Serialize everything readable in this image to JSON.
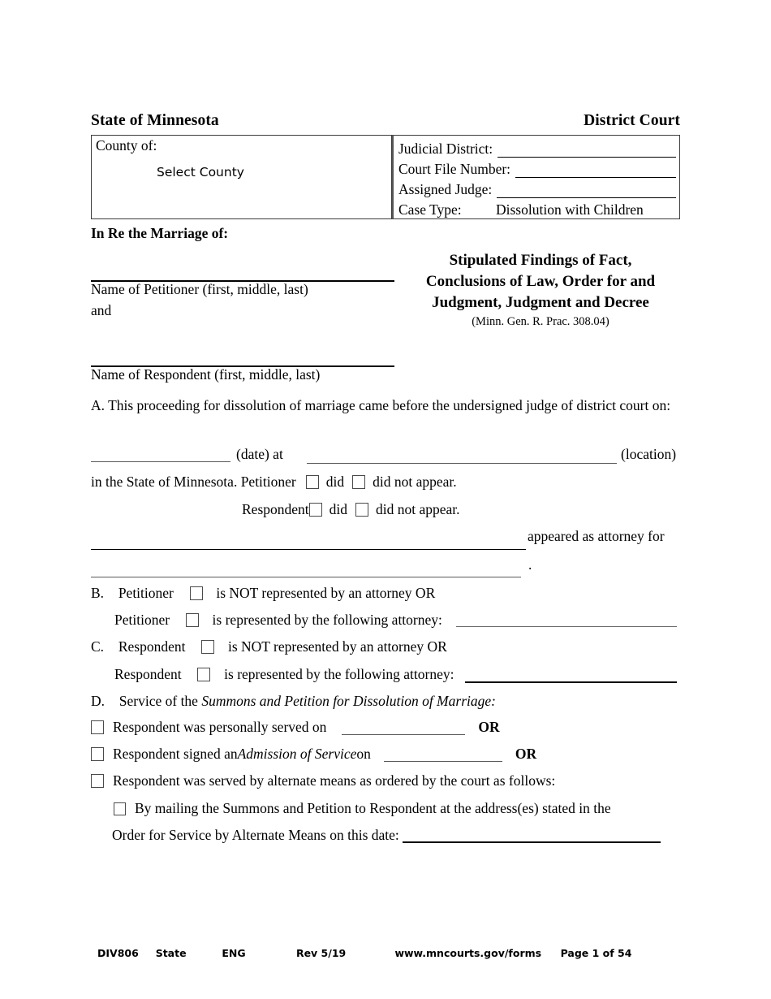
{
  "header": {
    "state": "State of Minnesota",
    "court": "District Court"
  },
  "caption": {
    "county_label": "County of:",
    "county_value": "Select County",
    "judicial_district_label": "Judicial District:",
    "judicial_district_value": "",
    "court_file_number_label": "Court File Number:",
    "court_file_number_value": "",
    "assigned_judge_label": "Assigned Judge:",
    "assigned_judge_value": "",
    "case_type_label": "Case Type:",
    "case_type_value": "Dissolution with Children"
  },
  "parties": {
    "in_re": "In Re the Marriage of:",
    "petitioner_caption": "Name of Petitioner (first, middle, last)",
    "and": "and",
    "respondent_caption": "Name of Respondent (first, middle, last)"
  },
  "document": {
    "title_line1": "Stipulated Findings of Fact,",
    "title_line2": "Conclusions of Law, Order for and",
    "title_line3": "Judgment, Judgment and Decree",
    "citation": "(Minn. Gen. R. Prac. 308.04)"
  },
  "section_a": {
    "text": "A. This proceeding for dissolution of marriage came before the undersigned judge of district court on:",
    "date_label": "(date) at",
    "location_label": "(location)",
    "state_phrase": "in the State of Minnesota. Petitioner",
    "did": "did",
    "did_not_appear": "did not appear.",
    "respondent": "Respondent",
    "appeared_as_attorney_for": "appeared as attorney for",
    "period": "."
  },
  "section_b": {
    "letter": "B.",
    "petitioner": "Petitioner",
    "not_represented": "is NOT represented by an attorney OR",
    "represented": "is represented by the following attorney:"
  },
  "section_c": {
    "letter": "C.",
    "respondent": "Respondent",
    "not_represented": "is NOT represented by an attorney OR",
    "represented": "is represented by the following attorney:"
  },
  "section_d": {
    "letter": "D.",
    "intro_plain": "Service of the ",
    "intro_italic": "Summons and Petition for Dissolution of Marriage:",
    "option1_text": "Respondent was personally served on",
    "option1_or": "OR",
    "option2_pre": "Respondent signed an ",
    "option2_italic": "Admission of Service",
    "option2_post": " on",
    "option2_or": "OR",
    "option3_text": "Respondent was served by alternate means as ordered by the court as follows:",
    "option3_sub_text": "By mailing the Summons and Petition to Respondent at the address(es) stated in the",
    "option3_sub_date_label": "Order for Service by Alternate Means on this date:"
  },
  "footer": {
    "form_number": "DIV806",
    "scope": "State",
    "language": "ENG",
    "revision": "Rev 5/19",
    "website": "www.mncourts.gov/forms",
    "page": "Page 1 of 54"
  }
}
